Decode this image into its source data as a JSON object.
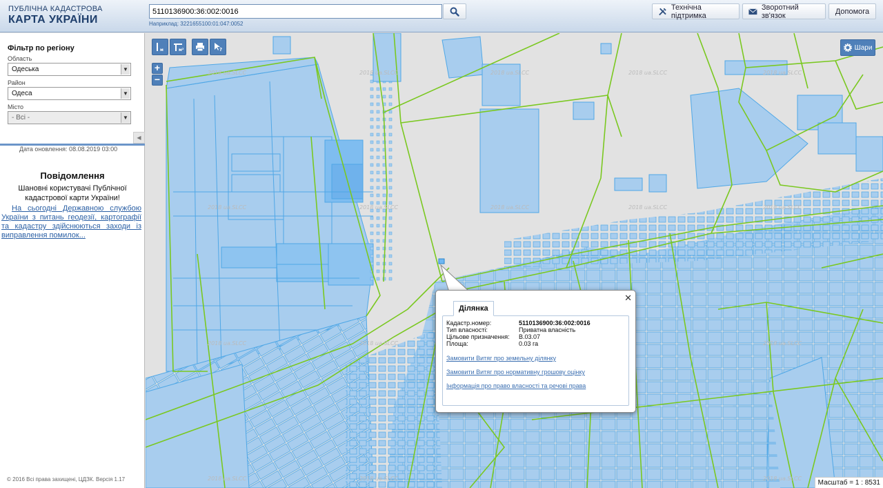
{
  "header": {
    "logo_line1": "ПУБЛІЧНА КАДАСТРОВА",
    "logo_line2": "КАРТА УКРАЇНИ",
    "search_value": "5110136900:36:002:0016",
    "search_example": "Наприклад: 3221655100:01:047:0052",
    "buttons": {
      "support": "Технічна підтримка",
      "feedback": "Зворотний зв'язок",
      "help": "Допомога"
    }
  },
  "sidebar": {
    "filter_title": "Фільтр по регіону",
    "oblast_label": "Область",
    "oblast_value": "Одеська",
    "rayon_label": "Район",
    "rayon_value": "Одеса",
    "misto_label": "Місто",
    "misto_value": "- Всі -",
    "update_date": "Дата оновлення: 08.08.2019 03:00",
    "message_title": "Повідомлення",
    "message_text": "Шановні користувачі Публічної кадастрової карти України!",
    "message_link": "На сьогодні Державною службою України з питань геодезії, картографії та кадастру здійснюються заходи із виправлення помилок...",
    "copyright": "© 2016 Всі права захищені, ЦДЗК. Версія 1.17"
  },
  "map": {
    "layers_label": "Шари",
    "scale": "Масштаб = 1 : 8531",
    "watermark": "2018 ua.SLCC",
    "colors": {
      "parcel_fill": "#a8cdee",
      "parcel_stroke": "#4fa7e6",
      "boundary": "#7ac820",
      "selected": "#6fb7f2"
    }
  },
  "popup": {
    "tab": "Ділянка",
    "rows": [
      {
        "key": "Кадастр.номер:",
        "value": "5110136900:36:002:0016"
      },
      {
        "key": "Тип власності:",
        "value": "Приватна власність"
      },
      {
        "key": "Цільове призначення:",
        "value": "В.03.07"
      },
      {
        "key": "Площа:",
        "value": "0.03 га"
      }
    ],
    "links": [
      "Замовити Витяг про земельну ділянку",
      "Замовити Витяг про нормативну грошову оцінку",
      "Інформація про право власності та речові права"
    ]
  }
}
